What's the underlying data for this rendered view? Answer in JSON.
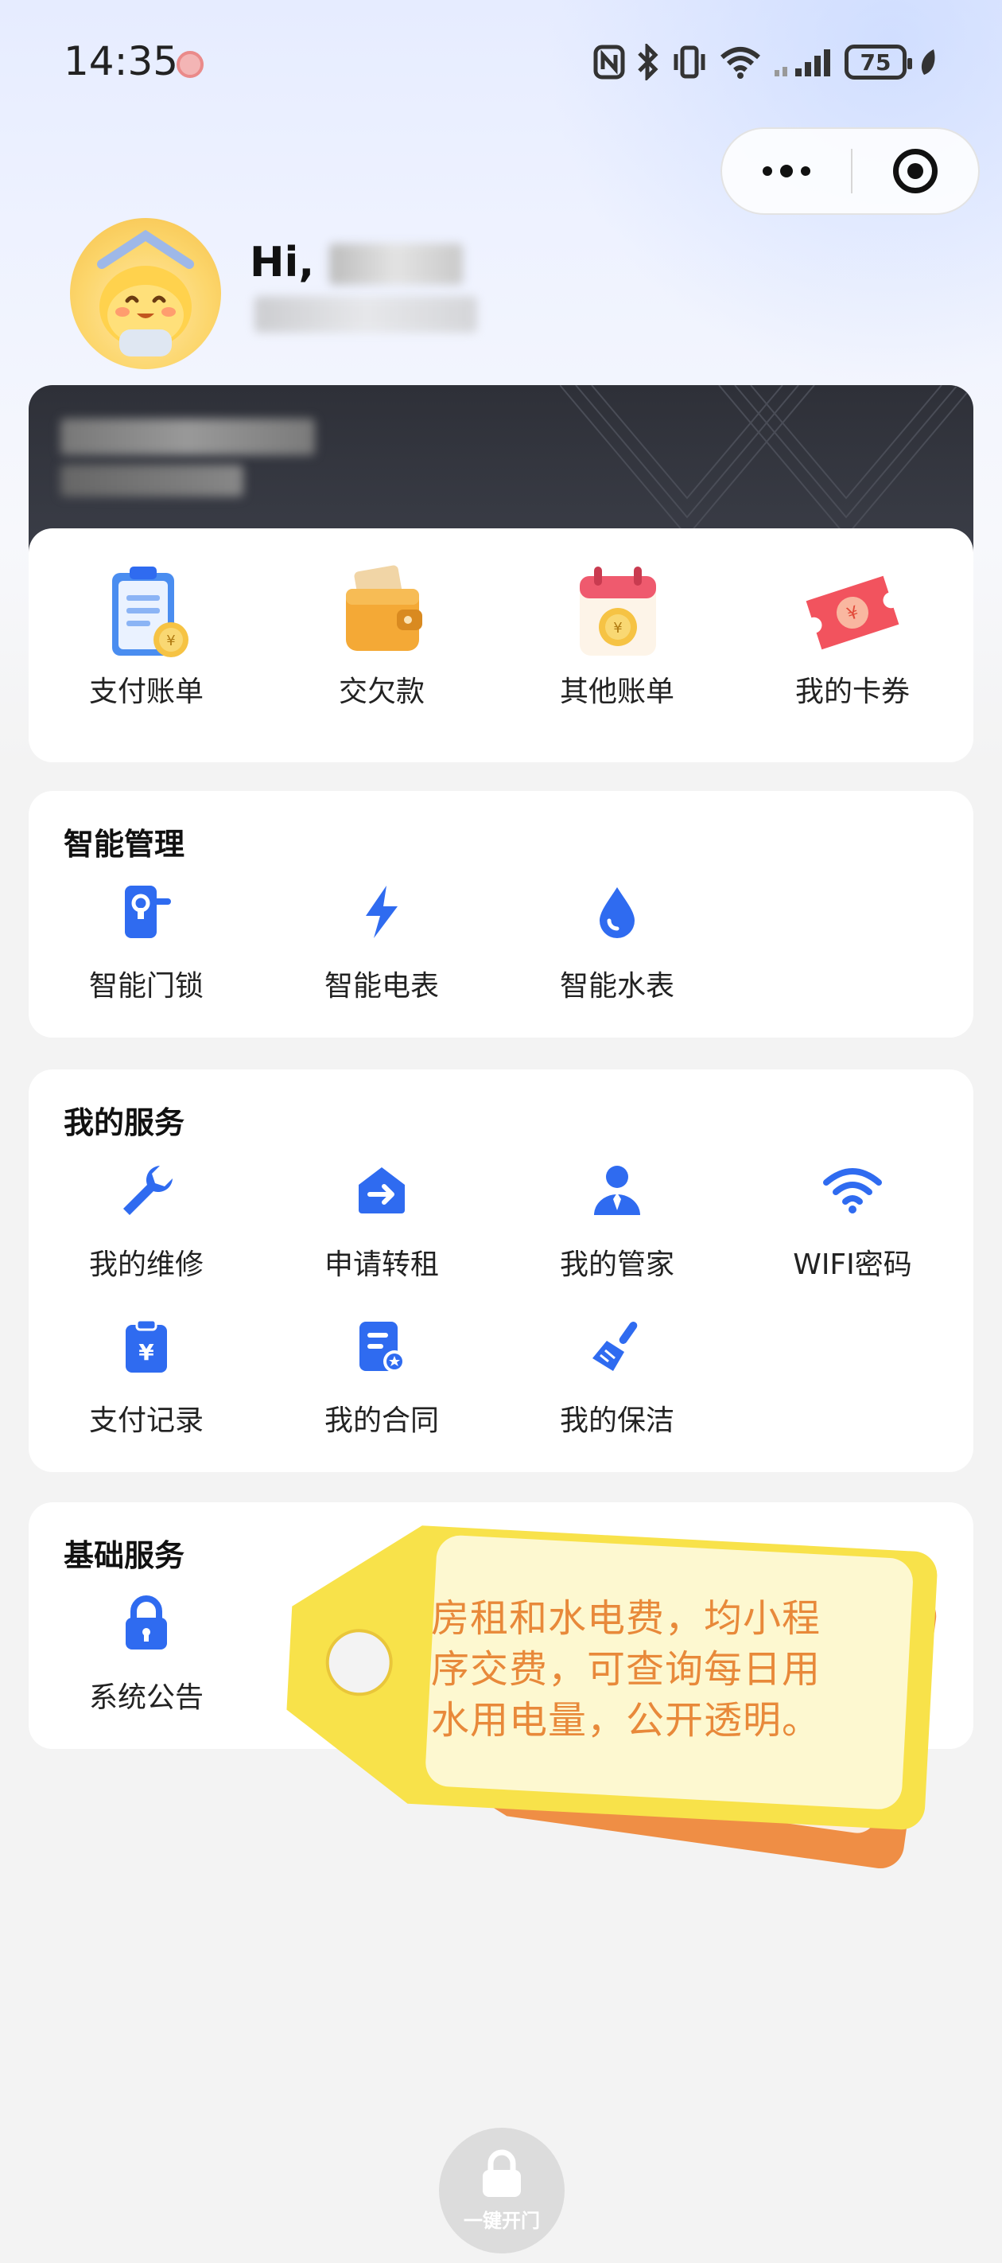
{
  "status_bar": {
    "time": "14:35",
    "battery": "75"
  },
  "profile": {
    "greeting": "Hi,"
  },
  "bills": {
    "items": [
      {
        "label": "支付账单",
        "icon": "clipboard-bill-icon"
      },
      {
        "label": "交欠款",
        "icon": "wallet-icon"
      },
      {
        "label": "其他账单",
        "icon": "calendar-bill-icon"
      },
      {
        "label": "我的卡券",
        "icon": "coupon-ticket-icon"
      }
    ]
  },
  "smart": {
    "title": "智能管理",
    "items": [
      {
        "label": "智能门锁",
        "icon": "door-lock-icon"
      },
      {
        "label": "智能电表",
        "icon": "lightning-icon"
      },
      {
        "label": "智能水表",
        "icon": "water-drop-icon"
      }
    ]
  },
  "services": {
    "title": "我的服务",
    "items": [
      {
        "label": "我的维修",
        "icon": "wrench-icon"
      },
      {
        "label": "申请转租",
        "icon": "transfer-house-icon"
      },
      {
        "label": "我的管家",
        "icon": "butler-icon"
      },
      {
        "label": "WIFI密码",
        "icon": "wifi-icon"
      },
      {
        "label": "支付记录",
        "icon": "payment-record-icon"
      },
      {
        "label": "我的合同",
        "icon": "contract-icon"
      },
      {
        "label": "我的保洁",
        "icon": "broom-icon"
      }
    ]
  },
  "basic": {
    "title": "基础服务",
    "items": [
      {
        "label": "系统公告",
        "icon": "lock-icon"
      }
    ]
  },
  "tag_note": {
    "lines": [
      "房租和水电费，均小程",
      "序交费，可查询每日用",
      "水用电量，公开透明。"
    ]
  },
  "open_door": {
    "label": "一键开门"
  },
  "colors": {
    "accent": "#2f6bf0",
    "tag_text": "#e8893a",
    "tag_yellow": "#f8e24a",
    "tag_orange": "#ef8e45"
  }
}
